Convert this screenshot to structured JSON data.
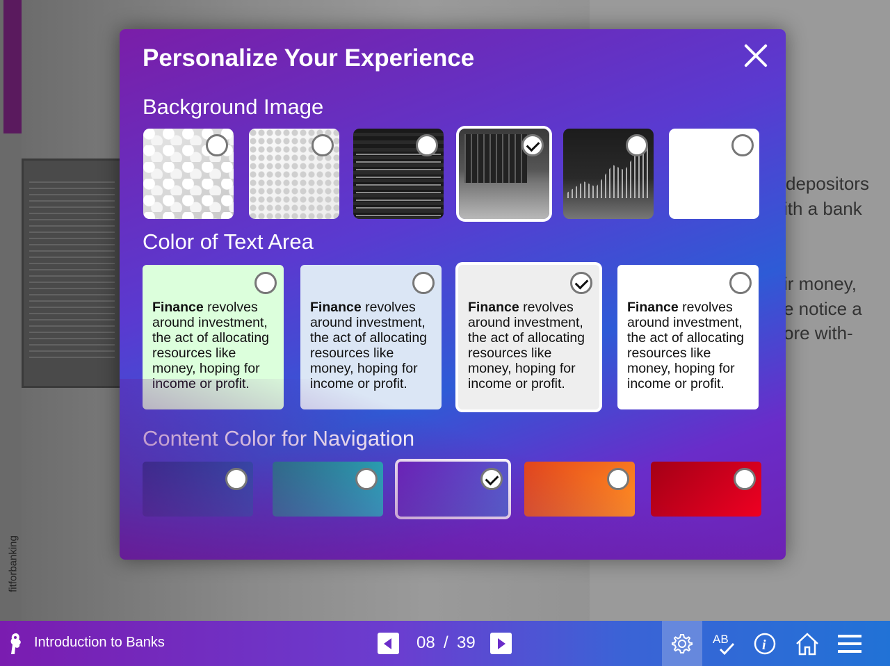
{
  "background_page": {
    "watermark": "fitforbanking",
    "visible_text_fragments": [
      "depositors",
      "ith a bank",
      "ir  money,",
      "e notice a",
      "ore   with-"
    ]
  },
  "modal": {
    "title": "Personalize Your Experience",
    "close_icon": "close-icon",
    "sections": {
      "background_image": {
        "title": "Background Image",
        "options": [
          {
            "name": "hexagon-pattern",
            "selected": false
          },
          {
            "name": "dot-pattern",
            "selected": false
          },
          {
            "name": "stock-ticker",
            "selected": false
          },
          {
            "name": "trading-desk",
            "selected": true
          },
          {
            "name": "candlestick-chart",
            "selected": false
          },
          {
            "name": "plain-white",
            "selected": false
          }
        ]
      },
      "text_area_color": {
        "title": "Color of Text Area",
        "sample_bold": "Finance",
        "sample_rest": " revolves around investment, the act of allocating resources like money, hoping for income or profit.",
        "options": [
          {
            "color": "#dcffdc",
            "selected": false
          },
          {
            "color": "#dbe6f5",
            "selected": false
          },
          {
            "color": "#eeeeee",
            "selected": true
          },
          {
            "color": "#ffffff",
            "selected": false
          }
        ]
      },
      "navigation_color": {
        "title": "Content Color for Navigation",
        "options": [
          {
            "from": "#0f3f8c",
            "to": "#1a72c4",
            "selected": false
          },
          {
            "from": "#119488",
            "to": "#1ad6cf",
            "selected": false
          },
          {
            "from": "#6a25c0",
            "to": "#4f6fd6",
            "selected": true
          },
          {
            "from": "#e5461a",
            "to": "#ff8f23",
            "selected": false
          },
          {
            "from": "#a40016",
            "to": "#ee0022",
            "selected": false
          }
        ]
      }
    }
  },
  "bottom_bar": {
    "course_title": "Introduction to Banks",
    "current_page": "08",
    "separator": "/",
    "total_pages": "39",
    "tools": [
      "gear-icon",
      "spellcheck-icon",
      "info-icon",
      "home-icon",
      "menu-icon"
    ]
  }
}
